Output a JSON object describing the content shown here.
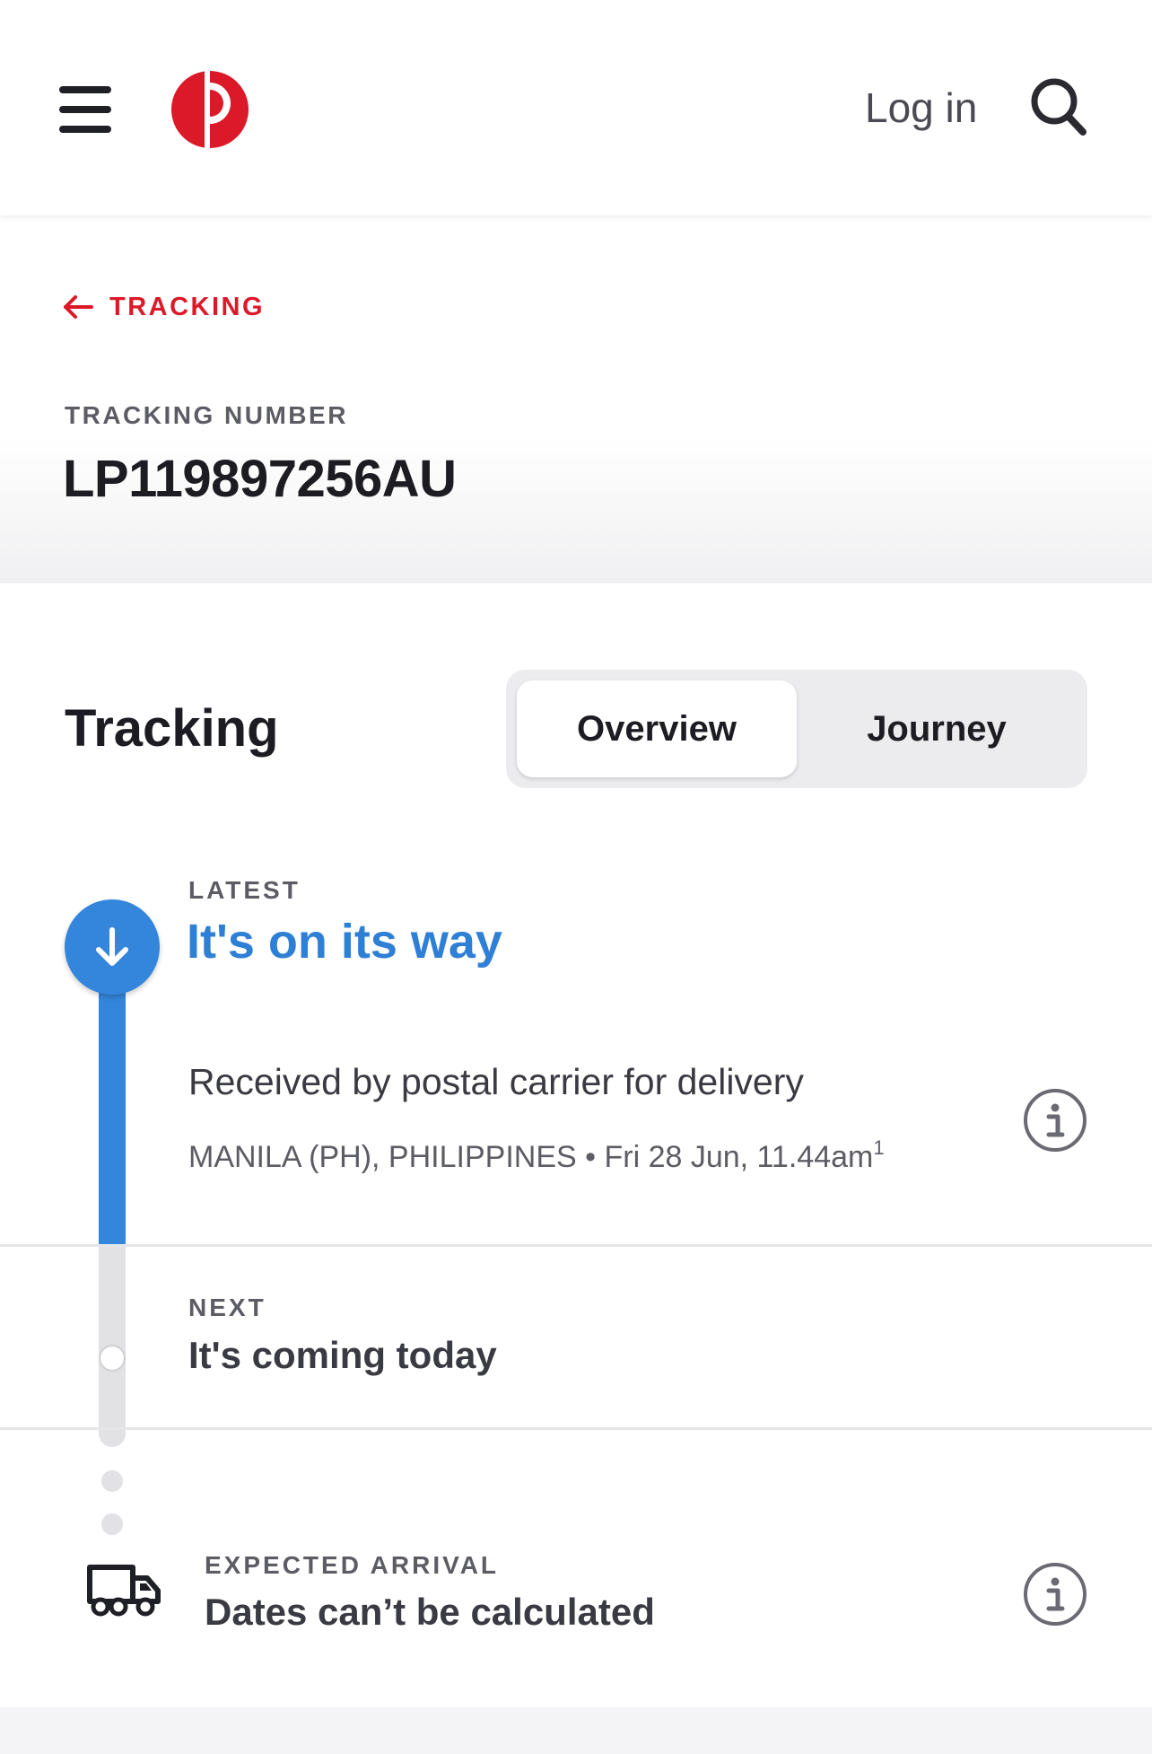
{
  "header": {
    "login_label": "Log in",
    "brand_color": "#dc1928"
  },
  "breadcrumb": {
    "back_label": "TRACKING"
  },
  "tracking": {
    "number_label": "TRACKING NUMBER",
    "number": "LP119897256AU"
  },
  "main": {
    "title": "Tracking",
    "tabs": [
      {
        "label": "Overview",
        "active": true
      },
      {
        "label": "Journey",
        "active": false
      }
    ]
  },
  "timeline": {
    "latest": {
      "label": "LATEST",
      "title": "It's on its way",
      "event_description": "Received by postal carrier for delivery",
      "event_location": "MANILA (PH), PHILIPPINES",
      "separator": "•",
      "event_time": "Fri 28 Jun, 11.44am",
      "footnote": "1"
    },
    "next": {
      "label": "NEXT",
      "title": "It's coming today"
    },
    "expected": {
      "label": "EXPECTED ARRIVAL",
      "title": "Dates can’t be calculated"
    }
  },
  "icons": {
    "menu": "hamburger-icon",
    "logo": "australia-post-logo",
    "search": "search-icon",
    "back": "arrow-left-icon",
    "latest": "arrow-down-icon",
    "info": "info-icon",
    "delivery": "truck-icon"
  },
  "colors": {
    "accent_blue": "#3386dc",
    "brand_red": "#dc1928",
    "track_grey": "#e2e2e5"
  }
}
